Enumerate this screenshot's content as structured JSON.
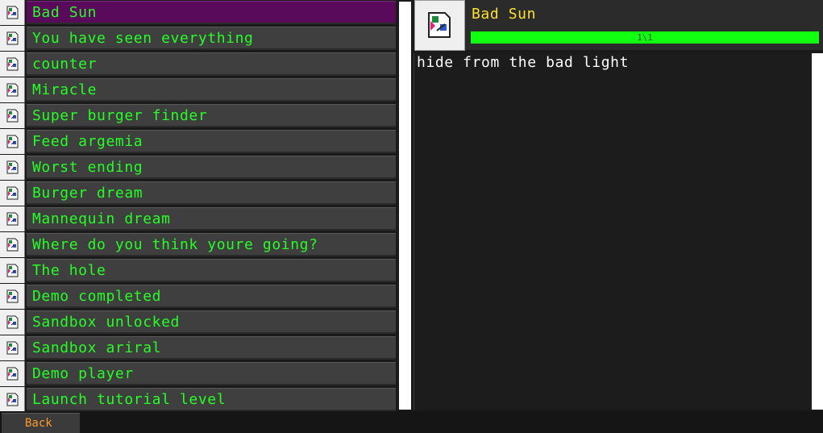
{
  "achievements": [
    {
      "label": "Bad Sun",
      "selected": true
    },
    {
      "label": "You have seen everything"
    },
    {
      "label": "counter"
    },
    {
      "label": "Miracle"
    },
    {
      "label": "Super burger finder"
    },
    {
      "label": "Feed argemia"
    },
    {
      "label": "Worst ending"
    },
    {
      "label": "Burger dream"
    },
    {
      "label": "Mannequin dream"
    },
    {
      "label": "Where do you think youre going?"
    },
    {
      "label": "The hole"
    },
    {
      "label": "Demo completed"
    },
    {
      "label": "Sandbox unlocked"
    },
    {
      "label": "Sandbox ariral"
    },
    {
      "label": "Demo player"
    },
    {
      "label": "Launch tutorial level"
    }
  ],
  "detail": {
    "title": "Bad Sun",
    "progress_text": "1\\1",
    "progress_fraction": 1.0,
    "description": "hide from the bad light"
  },
  "footer": {
    "back_label": "Back"
  },
  "colors": {
    "label_text": "#24ff24",
    "title_text": "#ffe02a",
    "progress_fill": "#11ff11",
    "selected_row": "#5a0a5a",
    "back_text": "#ff9a2a"
  },
  "icons": {
    "row_icon": "broken-image-icon",
    "detail_icon": "broken-image-icon"
  }
}
